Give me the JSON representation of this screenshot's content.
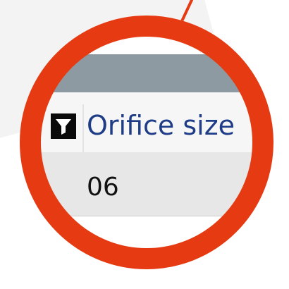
{
  "grid": {
    "column_header": "Orifice size",
    "rows": [
      {
        "orifice_size": "06"
      }
    ]
  },
  "icons": {
    "filter": "filter-icon"
  },
  "colors": {
    "highlight_ring": "#e63a12",
    "header_text": "#1f3d86",
    "titlebar": "#8d9aa1",
    "row_background": "#e7e7e7"
  }
}
